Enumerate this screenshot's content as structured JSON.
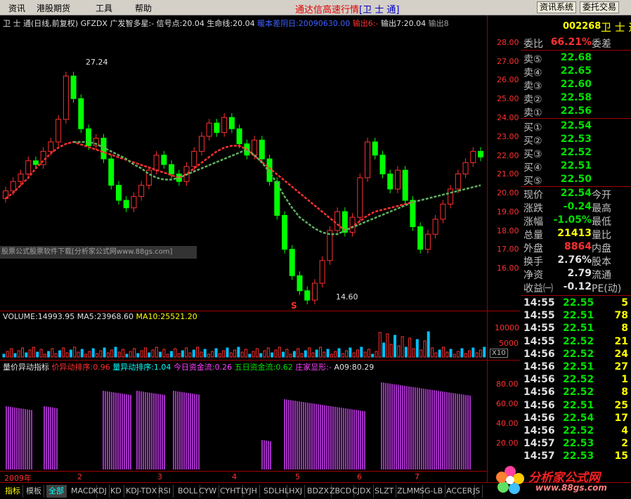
{
  "menu": {
    "items": [
      "资讯",
      "港股期货",
      "工具",
      "帮助"
    ],
    "title_prefix": "通达信高速行情",
    "title_stock": "[卫 士 通]",
    "btn_info": "资讯系统",
    "btn_trade": "委托交易"
  },
  "main_chart": {
    "header": [
      "卫 士 通(日线,前复权)",
      "GFZDX",
      "广发智多星:-",
      "信号点:20.04",
      "生命线:20.04",
      "暖本差阴日:20090630.00",
      "输出6:-",
      "输出7:20.04",
      "输出8"
    ],
    "y_ticks": [
      "28.00",
      "27.00",
      "26.00",
      "25.00",
      "24.00",
      "23.00",
      "22.00",
      "21.00",
      "20.00",
      "19.00",
      "18.00",
      "17.00",
      "16.00"
    ],
    "high_label": "27.24",
    "low_label": "14.60",
    "watermark": "股票公式股票软件下载[分析家公式网www.88gs.com]",
    "s_marker": "S",
    "candle_colors": {
      "up": "#ff3030",
      "down": "#00ff00",
      "line_red": "#ff3030",
      "line_green": "#60c060"
    }
  },
  "volume_chart": {
    "header": [
      "VOLUME:14993.95",
      "MA5:23968.60",
      "MA10:25521.20"
    ],
    "y_ticks": [
      "10000",
      "5000"
    ],
    "unit": "X10"
  },
  "indicator_chart": {
    "header": [
      "量价异动指标",
      "价异动排序:0.96",
      "量异动排序:1.04",
      "今日资金流:0.26",
      "五日资金流:0.62",
      "庄家显形:-",
      "A09:80.29"
    ],
    "y_ticks": [
      "80.00",
      "60.00",
      "40.00",
      "20.00"
    ],
    "x_labels": [
      "2009年",
      "2",
      "3",
      "4",
      "5",
      "6",
      "7"
    ]
  },
  "quote": {
    "code": "002268",
    "name": "卫 士 通",
    "ratio_label": "委比",
    "ratio_value": "66.21%",
    "diff_label": "委差",
    "sells": [
      {
        "label": "卖⑤",
        "price": "22.68"
      },
      {
        "label": "卖④",
        "price": "22.65"
      },
      {
        "label": "卖③",
        "price": "22.60"
      },
      {
        "label": "卖②",
        "price": "22.58"
      },
      {
        "label": "卖①",
        "price": "22.56"
      }
    ],
    "buys": [
      {
        "label": "买①",
        "price": "22.54"
      },
      {
        "label": "买②",
        "price": "22.53"
      },
      {
        "label": "买③",
        "price": "22.52"
      },
      {
        "label": "买④",
        "price": "22.51"
      },
      {
        "label": "买⑤",
        "price": "22.50"
      }
    ],
    "stats": [
      {
        "label": "现价",
        "value": "22.54",
        "label2": "今开",
        "color": "green"
      },
      {
        "label": "涨跌",
        "value": "-0.24",
        "label2": "最高",
        "color": "green"
      },
      {
        "label": "涨幅",
        "value": "-1.05%",
        "label2": "最低",
        "color": "green"
      },
      {
        "label": "总量",
        "value": "21413",
        "label2": "量比",
        "color": "yellow"
      },
      {
        "label": "外盘",
        "value": "8864",
        "label2": "内盘",
        "color": "red"
      },
      {
        "label": "换手",
        "value": "2.76%",
        "label2": "股本",
        "color": "white"
      },
      {
        "label": "净资",
        "value": "2.79",
        "label2": "流通",
        "color": "white"
      },
      {
        "label": "收益㈠",
        "value": "-0.12",
        "label2": "PE(动)",
        "color": "white"
      }
    ],
    "trades": [
      {
        "time": "14:55",
        "price": "22.55",
        "vol": "5"
      },
      {
        "time": "14:55",
        "price": "22.51",
        "vol": "78"
      },
      {
        "time": "14:55",
        "price": "22.51",
        "vol": "8"
      },
      {
        "time": "14:55",
        "price": "22.52",
        "vol": "21"
      },
      {
        "time": "14:56",
        "price": "22.52",
        "vol": "24"
      },
      {
        "time": "14:56",
        "price": "22.51",
        "vol": "27"
      },
      {
        "time": "14:56",
        "price": "22.52",
        "vol": "1"
      },
      {
        "time": "14:56",
        "price": "22.52",
        "vol": "8"
      },
      {
        "time": "14:56",
        "price": "22.51",
        "vol": "25"
      },
      {
        "time": "14:56",
        "price": "22.54",
        "vol": "17"
      },
      {
        "time": "14:56",
        "price": "22.52",
        "vol": "4"
      },
      {
        "time": "14:57",
        "price": "22.53",
        "vol": "2"
      },
      {
        "time": "14:57",
        "price": "22.53",
        "vol": "15"
      }
    ]
  },
  "tabs": [
    "指标",
    "模板",
    "全部",
    "MACD",
    "KDJ",
    "KD",
    "KDJ-TDX",
    "RSI",
    "BOLL",
    "CYW",
    "CYHT",
    "LYJH",
    "SDLH",
    "LHXJ",
    "BDZX",
    "ZBCD",
    "CJDX",
    "SLZT",
    "ZLMM",
    "SG-LB",
    "ACCER",
    "JS"
  ],
  "logo": {
    "text": "分析家公式网",
    "url": "www.88gs.com"
  }
}
